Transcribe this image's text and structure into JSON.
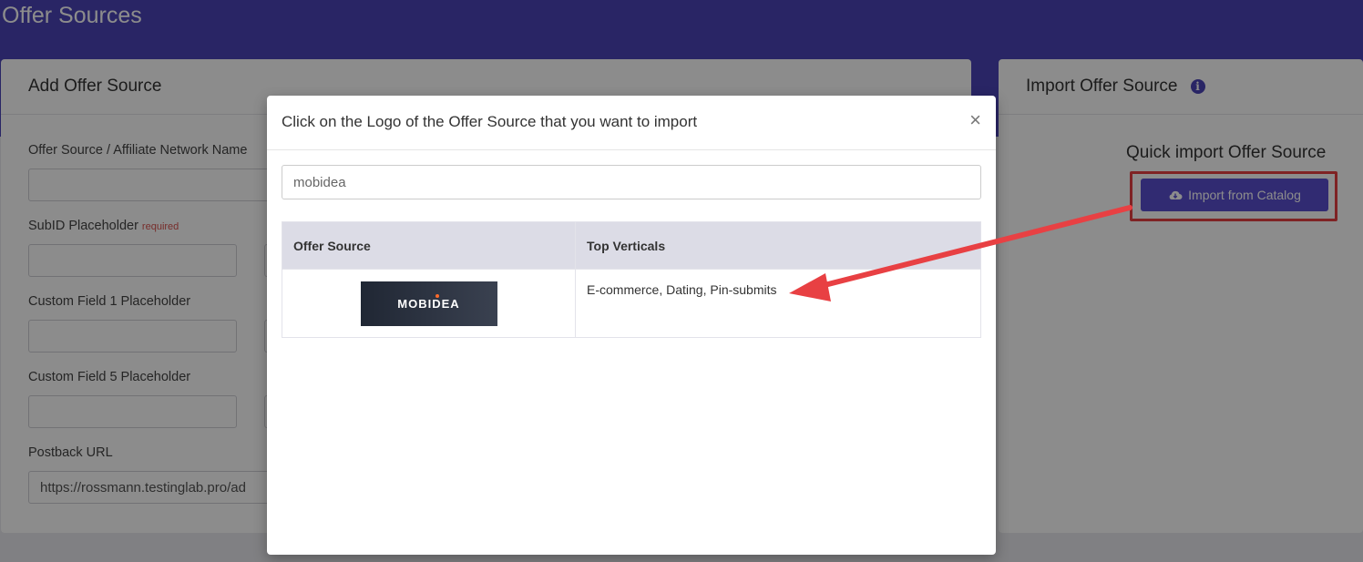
{
  "page": {
    "title": "Offer Sources"
  },
  "add_card": {
    "title": "Add Offer Source",
    "fields": {
      "network_name_label": "Offer Source / Affiliate Network Name",
      "subid_label": "SubID Placeholder",
      "subid_required": "required",
      "custom1_label": "Custom Field 1 Placeholder",
      "custom5_label": "Custom Field 5 Placeholder",
      "postback_label": "Postback URL",
      "postback_value": "https://rossmann.testinglab.pro/ad"
    }
  },
  "import_card": {
    "title": "Import Offer Source",
    "info_icon": "info-icon",
    "quick_title": "Quick import Offer Source",
    "import_button": "Import from Catalog",
    "button_icon": "cloud-download-icon"
  },
  "modal": {
    "title": "Click on the Logo of the Offer Source that you want to import",
    "close": "×",
    "search_value": "mobidea",
    "table": {
      "headers": [
        "Offer Source",
        "Top Verticals"
      ],
      "rows": [
        {
          "logo_text": "MOBIDEA",
          "verticals": "E-commerce, Dating, Pin-submits"
        }
      ]
    }
  },
  "colors": {
    "brand": "#4b44b8",
    "button": "#5a4fcf",
    "highlight": "#e84043"
  }
}
